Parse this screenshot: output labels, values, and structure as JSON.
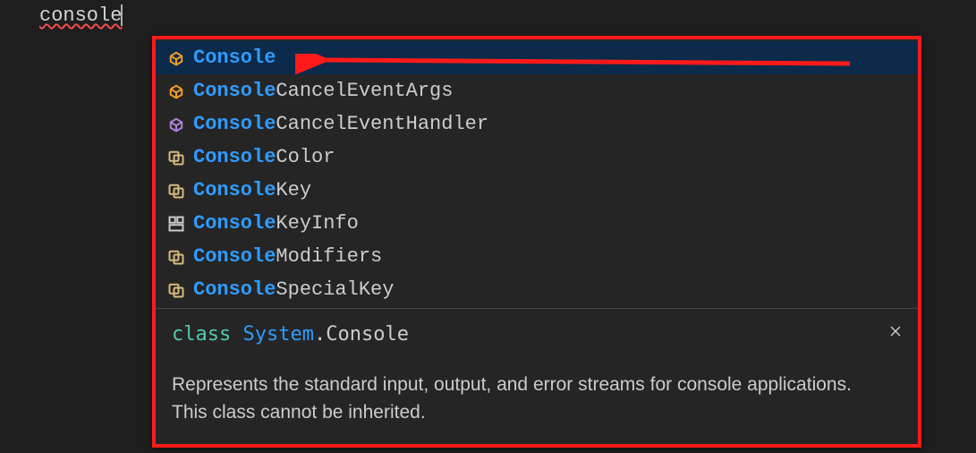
{
  "editor": {
    "typed_text": "console"
  },
  "suggestions": {
    "match_prefix": "Console",
    "items": [
      {
        "icon": "class",
        "rest": "",
        "selected": true
      },
      {
        "icon": "class",
        "rest": "CancelEventArgs",
        "selected": false
      },
      {
        "icon": "module",
        "rest": "CancelEventHandler",
        "selected": false
      },
      {
        "icon": "enum",
        "rest": "Color",
        "selected": false
      },
      {
        "icon": "enum",
        "rest": "Key",
        "selected": false
      },
      {
        "icon": "struct",
        "rest": "KeyInfo",
        "selected": false
      },
      {
        "icon": "enum",
        "rest": "Modifiers",
        "selected": false
      },
      {
        "icon": "enum",
        "rest": "SpecialKey",
        "selected": false
      }
    ]
  },
  "detail": {
    "keyword": "class",
    "namespace": "System",
    "member": "Console",
    "description": "Represents the standard input, output, and error streams for console applications. This class cannot be inherited."
  },
  "colors": {
    "accent_match": "#2f9cff",
    "annotation": "#ff1a1a",
    "selection_bg": "#0c2a4a",
    "icon_class": "#ee9d28",
    "icon_module": "#b180d7",
    "icon_enum": "#d7ba7d",
    "icon_struct": "#cccccc"
  }
}
